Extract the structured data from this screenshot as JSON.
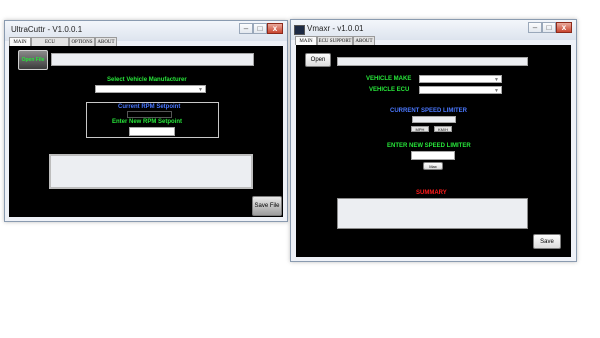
{
  "left_window": {
    "title": "UltraCuttr - V1.0.0.1",
    "tabs": [
      "MAIN",
      "ECU COVERAGE",
      "OPTIONS",
      "ABOUT"
    ],
    "open_button_label": "Open File",
    "file_path_value": "",
    "select_manufacturer_label": "Select Vehicle Manufacturer",
    "manufacturer_value": "",
    "current_rpm_label": "Current RPM Setpoint",
    "current_rpm_value": "",
    "new_rpm_label": "Enter New RPM Setpoint",
    "new_rpm_value": "",
    "log_value": "",
    "save_button_label": "Save File"
  },
  "right_window": {
    "title": "Vmaxr - v1.0.01",
    "tabs": [
      "MAIN",
      "ECU SUPPORT",
      "ABOUT"
    ],
    "open_button_label": "Open",
    "file_path_value": "",
    "vehicle_make_label": "VEHICLE MAKE",
    "vehicle_make_value": "",
    "vehicle_ecu_label": "VEHICLE ECU",
    "vehicle_ecu_value": "",
    "current_speed_label": "CURRENT SPEED LIMITER",
    "current_speed_value": "",
    "unit_buttons": [
      "MPH",
      "KM/H"
    ],
    "new_speed_label": "ENTER NEW SPEED LIMITER",
    "new_speed_value": "",
    "max_button_label": "Max",
    "summary_label": "SUMMARY",
    "summary_value": "",
    "save_button_label": "Save"
  },
  "window_controls": {
    "minimize": "–",
    "maximize": "□",
    "close": "x"
  },
  "colors": {
    "label_green": "#27e63a",
    "label_blue": "#4a78ff",
    "label_red": "#ff1a1a",
    "panel_background": "#000000"
  }
}
